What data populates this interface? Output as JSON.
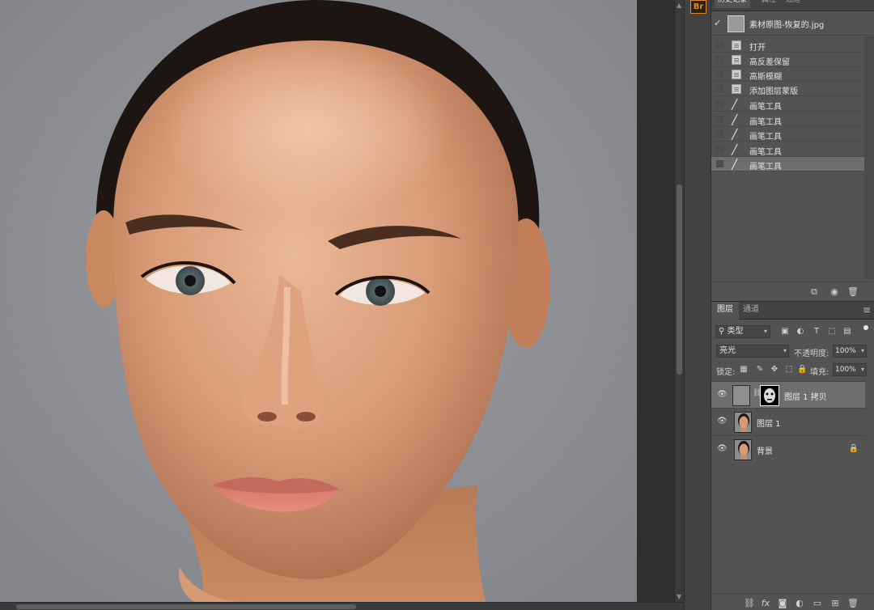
{
  "app": {
    "bridge_badge": "Br"
  },
  "history": {
    "tabs": [
      "历史记录",
      "属性",
      "通道"
    ],
    "snapshot_name": "素材原图-恢复的.jpg",
    "items": [
      {
        "label": "打开",
        "icon": "document-icon",
        "active": false
      },
      {
        "label": "高反差保留",
        "icon": "document-icon",
        "active": false
      },
      {
        "label": "高斯模糊",
        "icon": "document-icon",
        "active": false
      },
      {
        "label": "添加图层蒙版",
        "icon": "document-icon",
        "active": false
      },
      {
        "label": "画笔工具",
        "icon": "brush-icon",
        "active": false
      },
      {
        "label": "画笔工具",
        "icon": "brush-icon",
        "active": false
      },
      {
        "label": "画笔工具",
        "icon": "brush-icon",
        "active": false
      },
      {
        "label": "画笔工具",
        "icon": "brush-icon",
        "active": false
      },
      {
        "label": "画笔工具",
        "icon": "brush-icon",
        "active": true
      }
    ]
  },
  "layers": {
    "tabs": [
      "图层",
      "通道"
    ],
    "filter": "类型",
    "blend_mode": "亮光",
    "opacity_label": "不透明度:",
    "opacity_value": "100%",
    "lock_label": "锁定:",
    "fill_label": "填充:",
    "fill_value": "100%",
    "items": [
      {
        "name": "图层 1 拷贝",
        "selected": true,
        "has_mask": true,
        "locked": false
      },
      {
        "name": "图层 1",
        "selected": false,
        "has_mask": false,
        "locked": false
      },
      {
        "name": "背景",
        "selected": false,
        "has_mask": false,
        "locked": true
      }
    ]
  },
  "colors": {
    "panel_bg": "#535353",
    "selected_row": "#6e6e6e",
    "canvas_bg": "#8b8d93",
    "bridge_accent": "#e0852b"
  }
}
